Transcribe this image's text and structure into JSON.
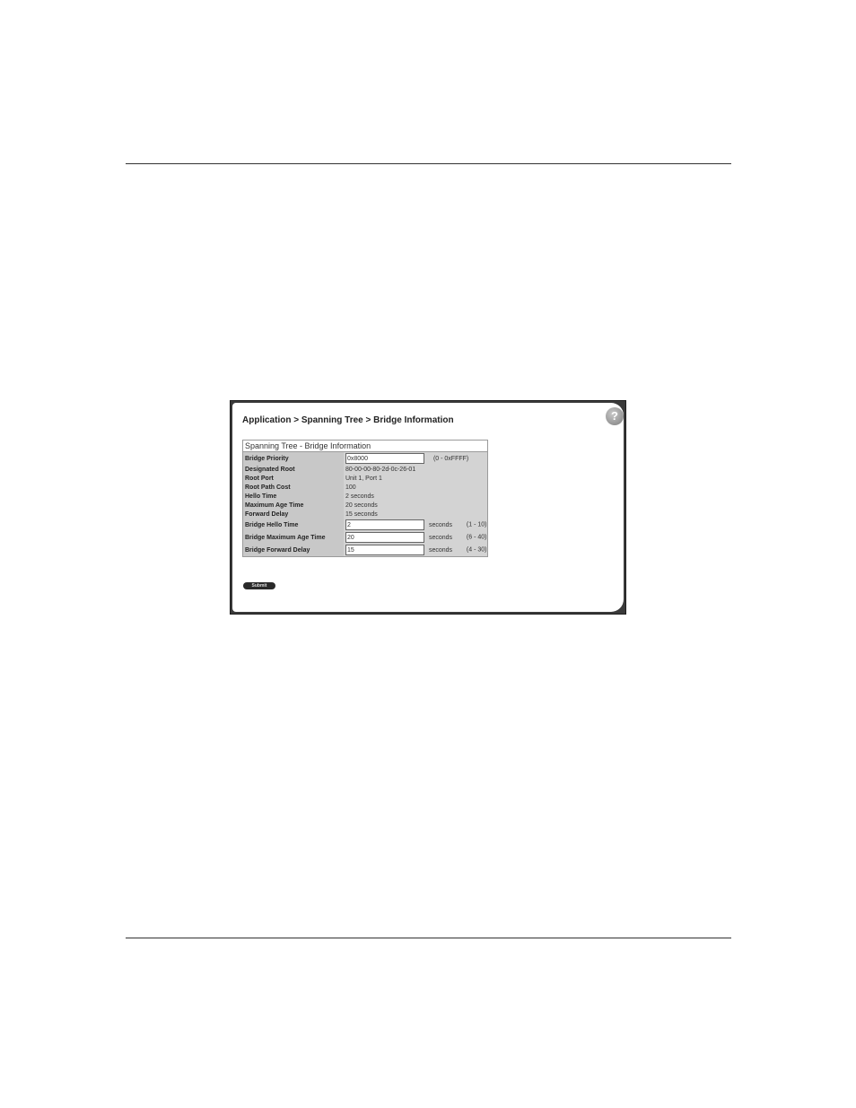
{
  "breadcrumb": "Application > Spanning Tree > Bridge Information",
  "help_icon": "question-mark",
  "table": {
    "title": "Spanning Tree - Bridge Information",
    "bridge_priority": {
      "label": "Bridge Priority",
      "value": "0x8000",
      "range": "(0 - 0xFFFF)"
    },
    "designated_root": {
      "label": "Designated Root",
      "value": "80-00-00-80-2d-0c-26-01"
    },
    "root_port": {
      "label": "Root Port",
      "value": "Unit 1, Port 1"
    },
    "root_path_cost": {
      "label": "Root Path Cost",
      "value": "100"
    },
    "hello_time": {
      "label": "Hello Time",
      "value": "2 seconds"
    },
    "max_age_time": {
      "label": "Maximum Age Time",
      "value": "20 seconds"
    },
    "forward_delay": {
      "label": "Forward Delay",
      "value": "15 seconds"
    },
    "bridge_hello_time": {
      "label": "Bridge Hello Time",
      "value": "2",
      "unit": "seconds",
      "range": "(1 - 10)"
    },
    "bridge_max_age_time": {
      "label": "Bridge Maximum Age Time",
      "value": "20",
      "unit": "seconds",
      "range": "(6 - 40)"
    },
    "bridge_forward_delay": {
      "label": "Bridge Forward Delay",
      "value": "15",
      "unit": "seconds",
      "range": "(4 - 30)"
    }
  },
  "submit_label": "Submit"
}
